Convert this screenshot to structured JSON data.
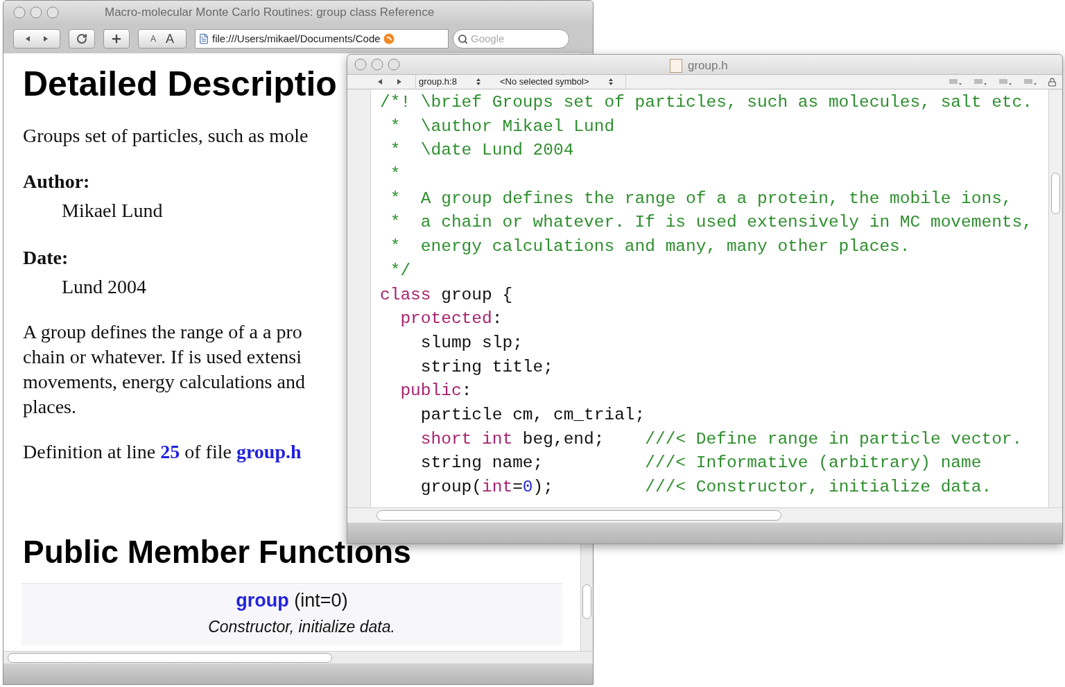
{
  "browser": {
    "title": "Macro-molecular Monte Carlo Routines: group class Reference",
    "toolbar": {
      "text_smaller": "A",
      "text_bigger": "A",
      "url": "file:///Users/mikael/Documents/Code",
      "search": {
        "placeholder": "Google"
      }
    },
    "content": {
      "heading": "Detailed Descriptio",
      "summary": "Groups set of particles, such as mole",
      "author_label": "Author:",
      "author": "Mikael Lund",
      "date_label": "Date:",
      "date": "Lund 2004",
      "paragraph_lines": [
        "A group defines the range of a a pro",
        "chain or whatever. If is used extensi",
        "movements, energy calculations and",
        "places."
      ],
      "definition": {
        "before": "Definition at line",
        "line_link": "25",
        "middle": "of file",
        "file_link": "group.h"
      },
      "section_heading": "Public Member Functions",
      "member": {
        "name_link": "group",
        "signature": "(int=0)",
        "description": "Constructor, initialize data."
      }
    }
  },
  "editor": {
    "title": "group.h",
    "file_popup": "group.h:8",
    "symbol_popup": "<No selected symbol>",
    "code_lines": [
      [
        {
          "kind": "comment",
          "text": "/*! \\brief Groups set of particles, such as molecules, salt etc."
        }
      ],
      [
        {
          "kind": "comment",
          "text": " *  \\author Mikael Lund"
        }
      ],
      [
        {
          "kind": "comment",
          "text": " *  \\date Lund 2004"
        }
      ],
      [
        {
          "kind": "comment",
          "text": " *"
        }
      ],
      [
        {
          "kind": "comment",
          "text": " *  A group defines the range of a a protein, the mobile ions,"
        }
      ],
      [
        {
          "kind": "comment",
          "text": " *  a chain or whatever. If is used extensively in MC movements,"
        }
      ],
      [
        {
          "kind": "comment",
          "text": " *  energy calculations and many, many other places."
        }
      ],
      [
        {
          "kind": "comment",
          "text": " */"
        }
      ],
      [
        {
          "kind": "keyword",
          "text": "class"
        },
        {
          "kind": "plain",
          "text": " group {"
        }
      ],
      [
        {
          "kind": "keyword",
          "text": "  protected"
        },
        {
          "kind": "plain",
          "text": ":"
        }
      ],
      [
        {
          "kind": "plain",
          "text": "    slump slp;"
        }
      ],
      [
        {
          "kind": "plain",
          "text": "    string title;"
        }
      ],
      [
        {
          "kind": "keyword",
          "text": "  public"
        },
        {
          "kind": "plain",
          "text": ":"
        }
      ],
      [
        {
          "kind": "plain",
          "text": "    particle cm, cm_trial;"
        }
      ],
      [
        {
          "kind": "keyword",
          "text": "    short int"
        },
        {
          "kind": "plain",
          "text": " beg,end;    "
        },
        {
          "kind": "comment",
          "text": "///< Define range in particle vector."
        }
      ],
      [
        {
          "kind": "plain",
          "text": "    string name;          "
        },
        {
          "kind": "comment",
          "text": "///< Informative (arbitrary) name"
        }
      ],
      [
        {
          "kind": "plain",
          "text": "    group("
        },
        {
          "kind": "keyword",
          "text": "int"
        },
        {
          "kind": "plain",
          "text": "="
        },
        {
          "kind": "number",
          "text": "0"
        },
        {
          "kind": "plain",
          "text": ");         "
        },
        {
          "kind": "comment",
          "text": "///< Constructor, initialize data."
        }
      ]
    ]
  }
}
